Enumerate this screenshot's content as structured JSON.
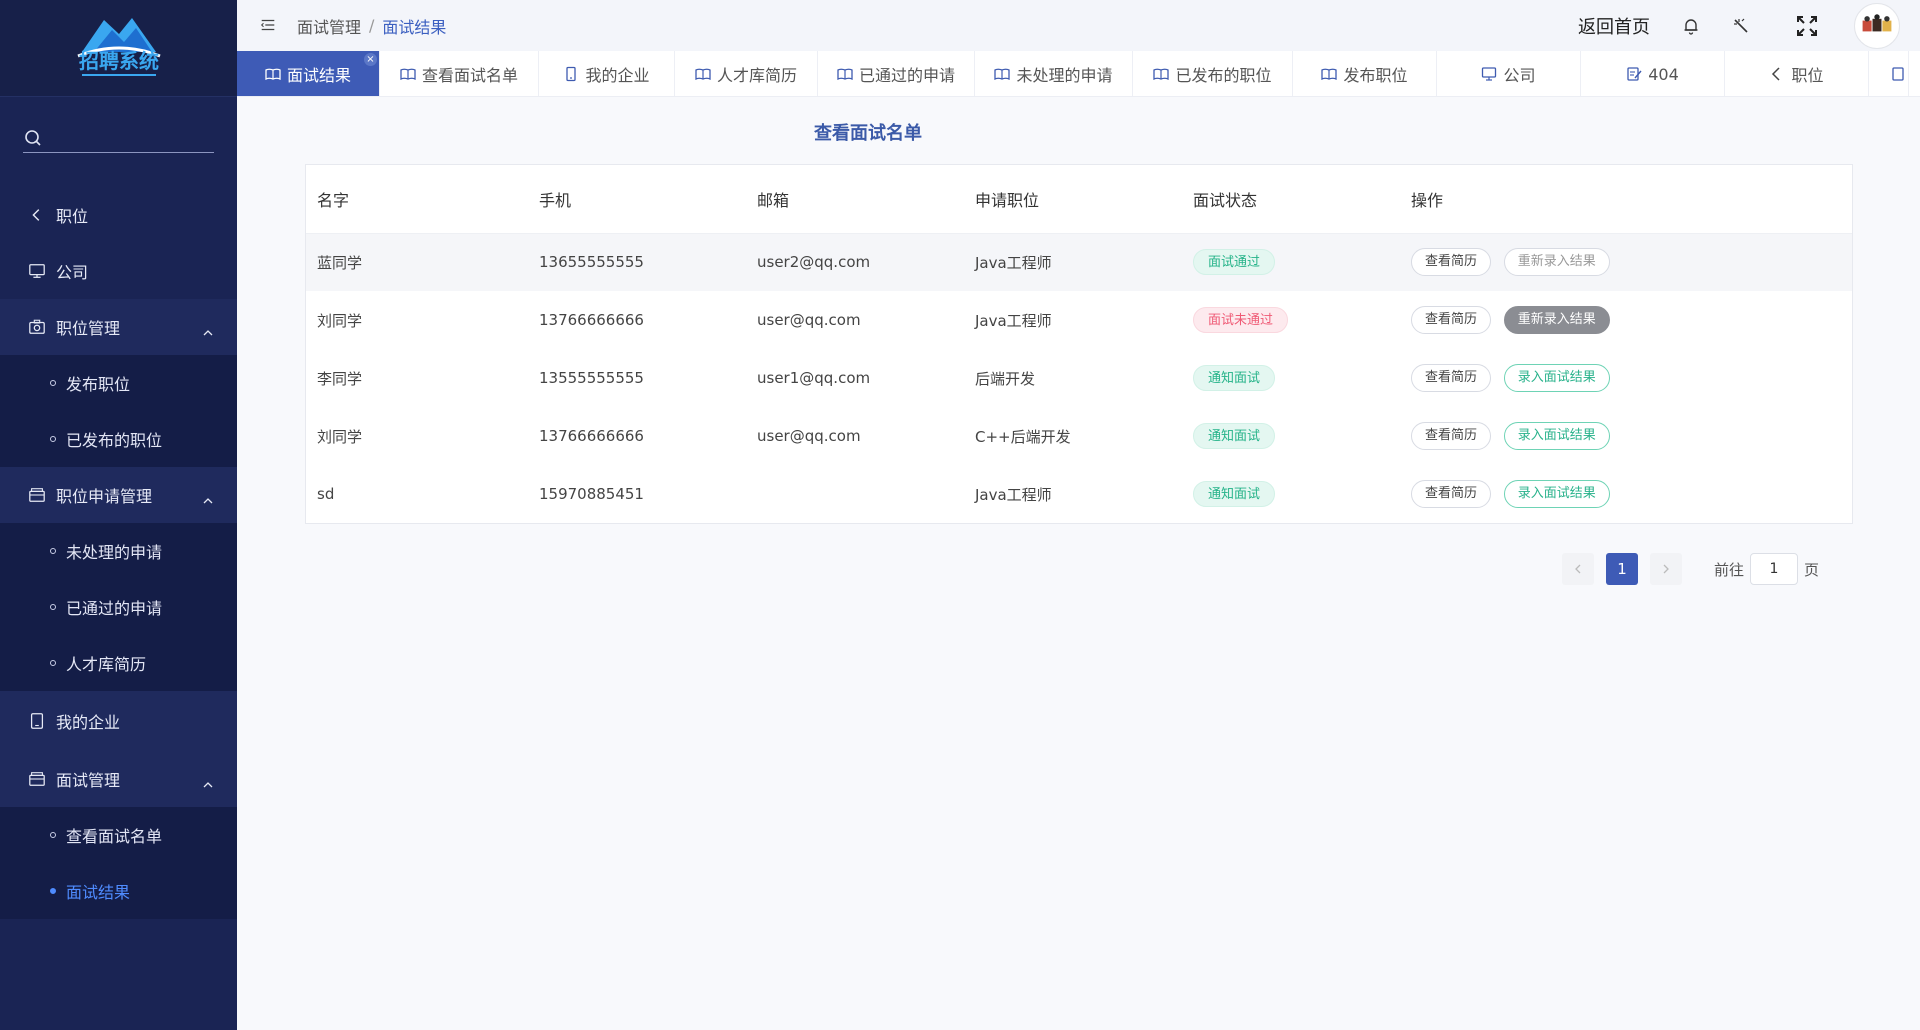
{
  "sidebar": {
    "search_placeholder": "",
    "logo_text": "招聘系统",
    "items": [
      {
        "label": "职位",
        "icon": "chevron-left-icon"
      },
      {
        "label": "公司",
        "icon": "monitor-icon"
      },
      {
        "label": "职位管理",
        "icon": "camera-icon"
      },
      {
        "label": "职位申请管理",
        "icon": "briefcase-icon"
      },
      {
        "label": "我的企业",
        "icon": "tablet-icon"
      },
      {
        "label": "面试管理",
        "icon": "briefcase-icon"
      }
    ],
    "sub_job": [
      "发布职位",
      "已发布的职位"
    ],
    "sub_apply": [
      "未处理的申请",
      "已通过的申请",
      "人才库简历"
    ],
    "sub_interview": [
      "查看面试名单",
      "面试结果"
    ]
  },
  "header": {
    "crumb1": "面试管理",
    "separator": "/",
    "crumb2": "面试结果",
    "home_link": "返回首页"
  },
  "tabs": [
    {
      "label": "面试结果",
      "active": true,
      "icon": "book-icon"
    },
    {
      "label": "查看面试名单",
      "icon": "book-icon"
    },
    {
      "label": "我的企业",
      "icon": "tablet-icon"
    },
    {
      "label": "人才库简历",
      "icon": "book-icon"
    },
    {
      "label": "已通过的申请",
      "icon": "book-icon"
    },
    {
      "label": "未处理的申请",
      "icon": "book-icon"
    },
    {
      "label": "已发布的职位",
      "icon": "book-icon"
    },
    {
      "label": "发布职位",
      "icon": "book-icon"
    },
    {
      "label": "公司",
      "icon": "monitor-icon"
    },
    {
      "label": "404",
      "icon": "edit-icon"
    },
    {
      "label": "职位",
      "icon": "chevron-left-icon"
    }
  ],
  "main": {
    "title": "查看面试名单",
    "columns": [
      "名字",
      "手机",
      "邮箱",
      "申请职位",
      "面试状态",
      "操作"
    ],
    "rows": [
      {
        "name": "蓝同学",
        "phone": "13655555555",
        "email": "user2@qq.com",
        "job": "Java工程师",
        "status": "面试通过",
        "status_type": "pass",
        "btn1": "查看简历",
        "btn2": "重新录入结果",
        "btn2_type": "muted"
      },
      {
        "name": "刘同学",
        "phone": "13766666666",
        "email": "user@qq.com",
        "job": "Java工程师",
        "status": "面试未通过",
        "status_type": "fail",
        "btn1": "查看简历",
        "btn2": "重新录入结果",
        "btn2_type": "dark"
      },
      {
        "name": "李同学",
        "phone": "13555555555",
        "email": "user1@qq.com",
        "job": "后端开发",
        "status": "通知面试",
        "status_type": "notice",
        "btn1": "查看简历",
        "btn2": "录入面试结果",
        "btn2_type": "green"
      },
      {
        "name": "刘同学",
        "phone": "13766666666",
        "email": "user@qq.com",
        "job": "C++后端开发",
        "status": "通知面试",
        "status_type": "notice",
        "btn1": "查看简历",
        "btn2": "录入面试结果",
        "btn2_type": "green"
      },
      {
        "name": "sd",
        "phone": "15970885451",
        "email": "",
        "job": "Java工程师",
        "status": "通知面试",
        "status_type": "notice",
        "btn1": "查看简历",
        "btn2": "录入面试结果",
        "btn2_type": "green"
      }
    ]
  },
  "pagination": {
    "current": "1",
    "goto_label": "前往",
    "goto_value": "1",
    "unit": "页"
  },
  "colors": {
    "sidebar_bg": "#1a2454",
    "accent": "#3e5bb6",
    "active_sub": "#4f8cff",
    "tag_green": "#25b389",
    "tag_red": "#ef5a75"
  }
}
